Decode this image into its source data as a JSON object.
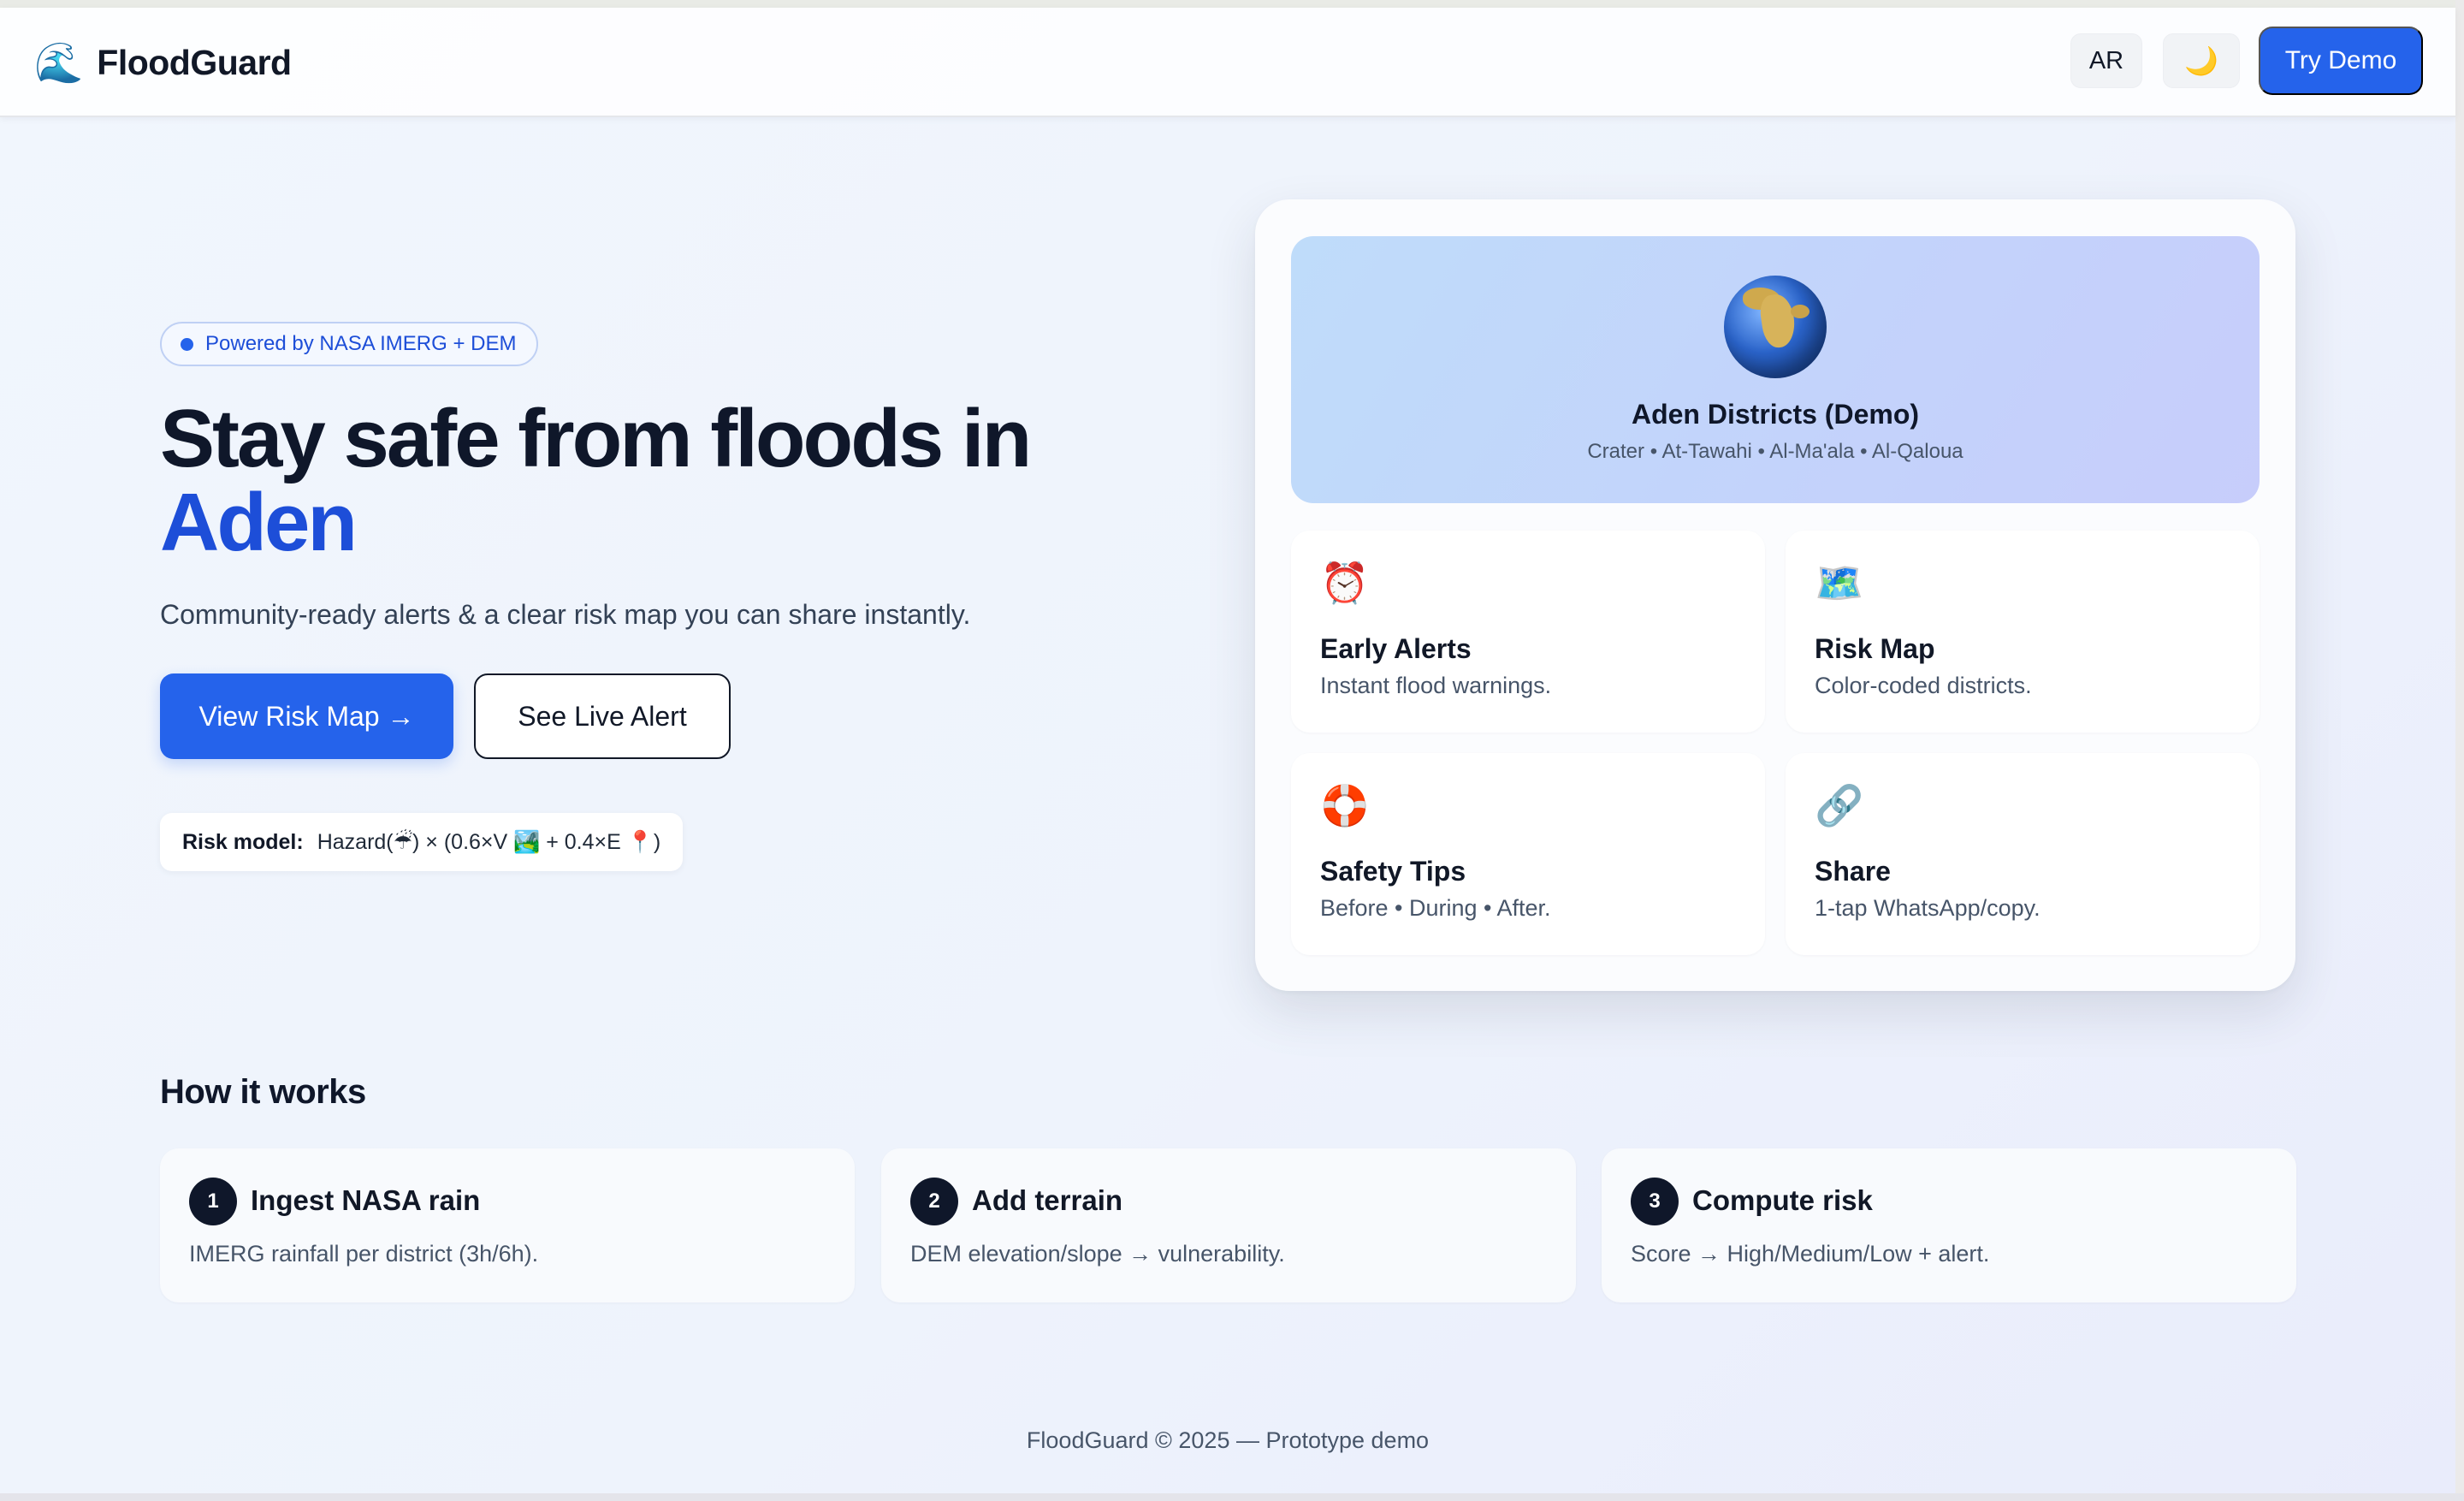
{
  "nav": {
    "brand_icon": "🌊",
    "brand_name": "FloodGuard",
    "lang_label": "AR",
    "theme_icon": "🌙",
    "demo_label": "Try Demo"
  },
  "hero": {
    "badge": "Powered by NASA IMERG + DEM",
    "title_line1": "Stay safe from floods in",
    "title_accent": "Aden",
    "subtitle": "Community-ready alerts & a clear risk map you can share instantly.",
    "primary_button": "View Risk Map →",
    "secondary_button": "See Live Alert",
    "risk_model_label": "Risk model:",
    "risk_model_formula": "Hazard(☔) × (0.6×V 🏞️ + 0.4×E 📍)"
  },
  "demo_card": {
    "map_title": "Aden Districts (Demo)",
    "map_subtitle": "Crater • At-Tawahi • Al-Ma'ala • Al-Qaloua",
    "features": [
      {
        "icon": "⏰",
        "icon_name": "alarm-clock-icon",
        "title": "Early Alerts",
        "desc": "Instant flood warnings."
      },
      {
        "icon": "🗺️",
        "icon_name": "map-icon",
        "title": "Risk Map",
        "desc": "Color-coded districts."
      },
      {
        "icon": "🛟",
        "icon_name": "lifebuoy-icon",
        "title": "Safety Tips",
        "desc": "Before • During • After."
      },
      {
        "icon": "🔗",
        "icon_name": "link-icon",
        "title": "Share",
        "desc": "1-tap WhatsApp/copy."
      }
    ]
  },
  "how": {
    "title": "How it works",
    "steps": [
      {
        "num": "1",
        "title": "Ingest NASA rain",
        "desc": "IMERG rainfall per district (3h/6h)."
      },
      {
        "num": "2",
        "title": "Add terrain",
        "desc": "DEM elevation/slope → vulnerability."
      },
      {
        "num": "3",
        "title": "Compute risk",
        "desc": "Score → High/Medium/Low + alert."
      }
    ]
  },
  "footer": {
    "text": "FloodGuard © 2025 — Prototype demo"
  },
  "colors": {
    "accent": "#2563eb",
    "accent_dark": "#1d4ed8",
    "text_dark": "#0f172a"
  }
}
